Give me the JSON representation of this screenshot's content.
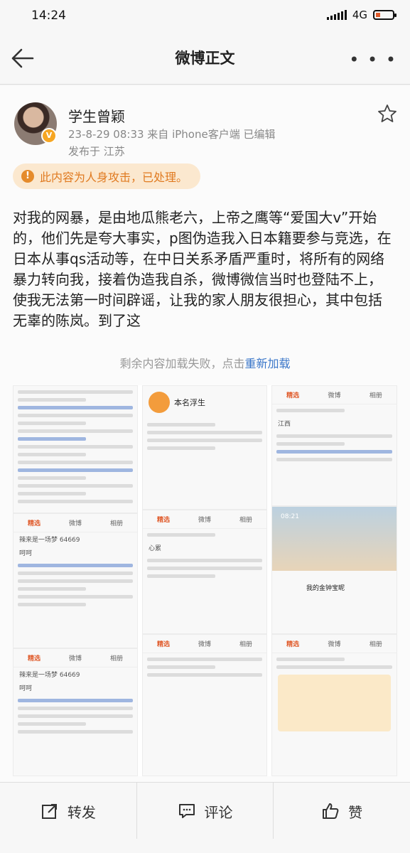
{
  "status_bar": {
    "time": "14:24",
    "network": "4G"
  },
  "nav": {
    "title": "微博正文",
    "more_icon": "more-icon"
  },
  "post": {
    "author": "学生曾颖",
    "verified_badge": "V",
    "meta": "23-8-29 08:33  来自 iPhone客户端  已编辑",
    "location": "发布于 江苏",
    "notice": "此内容为人身攻击，已处理。",
    "body": "对我的网暴，是由地瓜熊老六，上帝之鹰等“爱国大v”开始的，他们先是夸大事实，p图伪造我入日本籍要参与竞选，在日本从事qs活动等，在中日关系矛盾严重时，将所有的网络暴力转向我，接着伪造我自杀，微博微信当时也登陆不上，使我无法第一时间辟谣，让我的家人朋友很担心，其中包括无辜的陈岚。到了这",
    "load_fail_text": "剩余内容加载失败，点击",
    "reload_link": "重新加载"
  },
  "image_text": {
    "profile_name": "本名浮生",
    "tabs": [
      "精选",
      "微博",
      "相册"
    ],
    "location_jx": "江西",
    "profile_name_2": "我的金钟宝昵",
    "time_0821": "08:21",
    "heart_text": "心累",
    "user_6": "辣来是一场梦 64669",
    "hehe": "呵呵"
  },
  "actions": {
    "repost": "转发",
    "comment": "评论",
    "like": "赞"
  },
  "colors": {
    "accent_orange": "#e07a20",
    "link_blue": "#3b77c9"
  }
}
